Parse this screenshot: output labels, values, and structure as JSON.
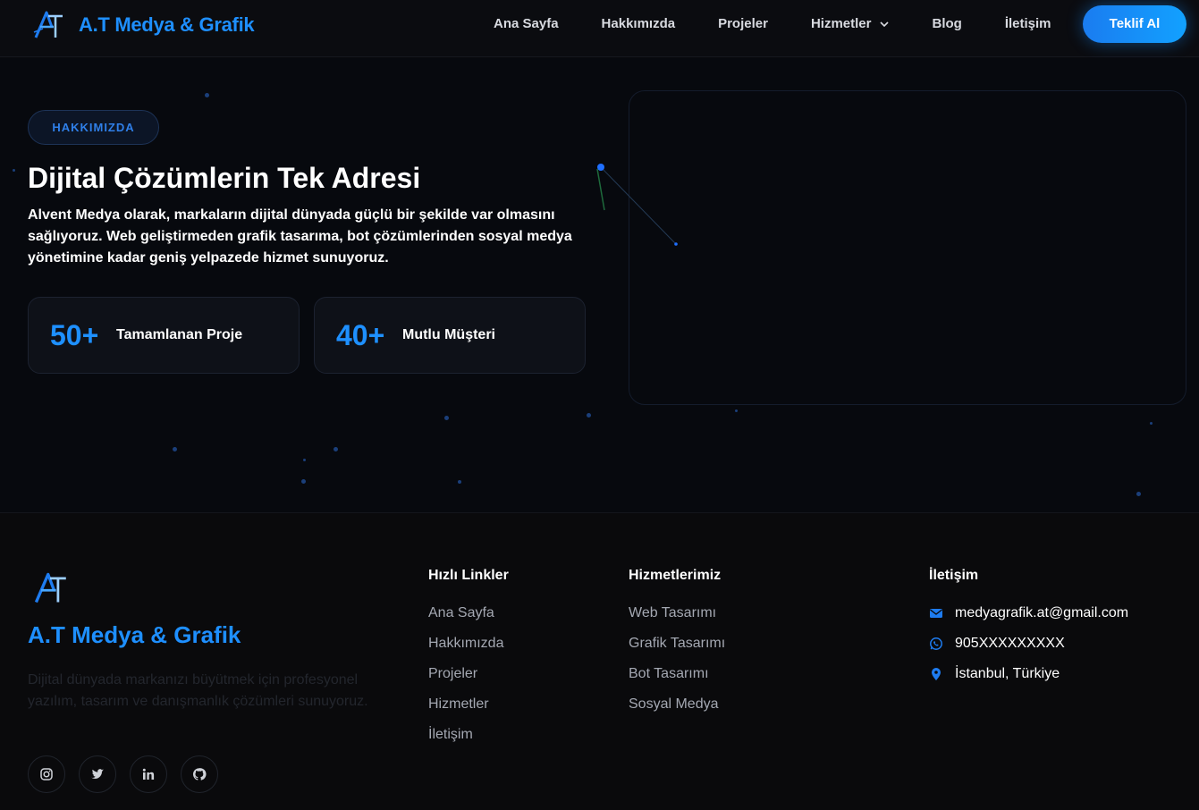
{
  "brand": {
    "name": "A.T Medya & Grafik"
  },
  "nav": {
    "items": [
      {
        "label": "Ana Sayfa"
      },
      {
        "label": "Hakkımızda"
      },
      {
        "label": "Projeler"
      },
      {
        "label": "Hizmetler"
      },
      {
        "label": "Blog"
      },
      {
        "label": "İletişim"
      }
    ],
    "cta": "Teklif Al"
  },
  "hero": {
    "badge": "HAKKIMIZDA",
    "title": "Dijital Çözümlerin Tek Adresi",
    "description": "Alvent Medya olarak, markaların dijital dünyada güçlü bir şekilde var olmasını sağlıyoruz. Web geliştirmeden grafik tasarıma, bot çözümlerinden sosyal medya yönetimine kadar geniş yelpazede hizmet sunuyoruz.",
    "stats": [
      {
        "value": "50+",
        "label": "Tamamlanan Proje"
      },
      {
        "value": "40+",
        "label": "Mutlu Müşteri"
      }
    ]
  },
  "footer": {
    "brand": "A.T Medya & Grafik",
    "description": "Dijital dünyada markanızı büyütmek için profesyonel yazılım, tasarım ve danışmanlık çözümleri sunuyoruz.",
    "socials": [
      "instagram-icon",
      "twitter-icon",
      "linkedin-icon",
      "github-icon"
    ],
    "quick_links": {
      "title": "Hızlı Linkler",
      "items": [
        "Ana Sayfa",
        "Hakkımızda",
        "Projeler",
        "Hizmetler",
        "İletişim"
      ]
    },
    "services": {
      "title": "Hizmetlerimiz",
      "items": [
        "Web Tasarımı",
        "Grafik Tasarımı",
        "Bot Tasarımı",
        "Sosyal Medya"
      ]
    },
    "contact": {
      "title": "İletişim",
      "email": "medyagrafik.at@gmail.com",
      "phone": "905XXXXXXXXX",
      "location": "İstanbul, Türkiye"
    }
  },
  "colors": {
    "accent": "#1e8fff",
    "background": "#0a0b0f"
  }
}
